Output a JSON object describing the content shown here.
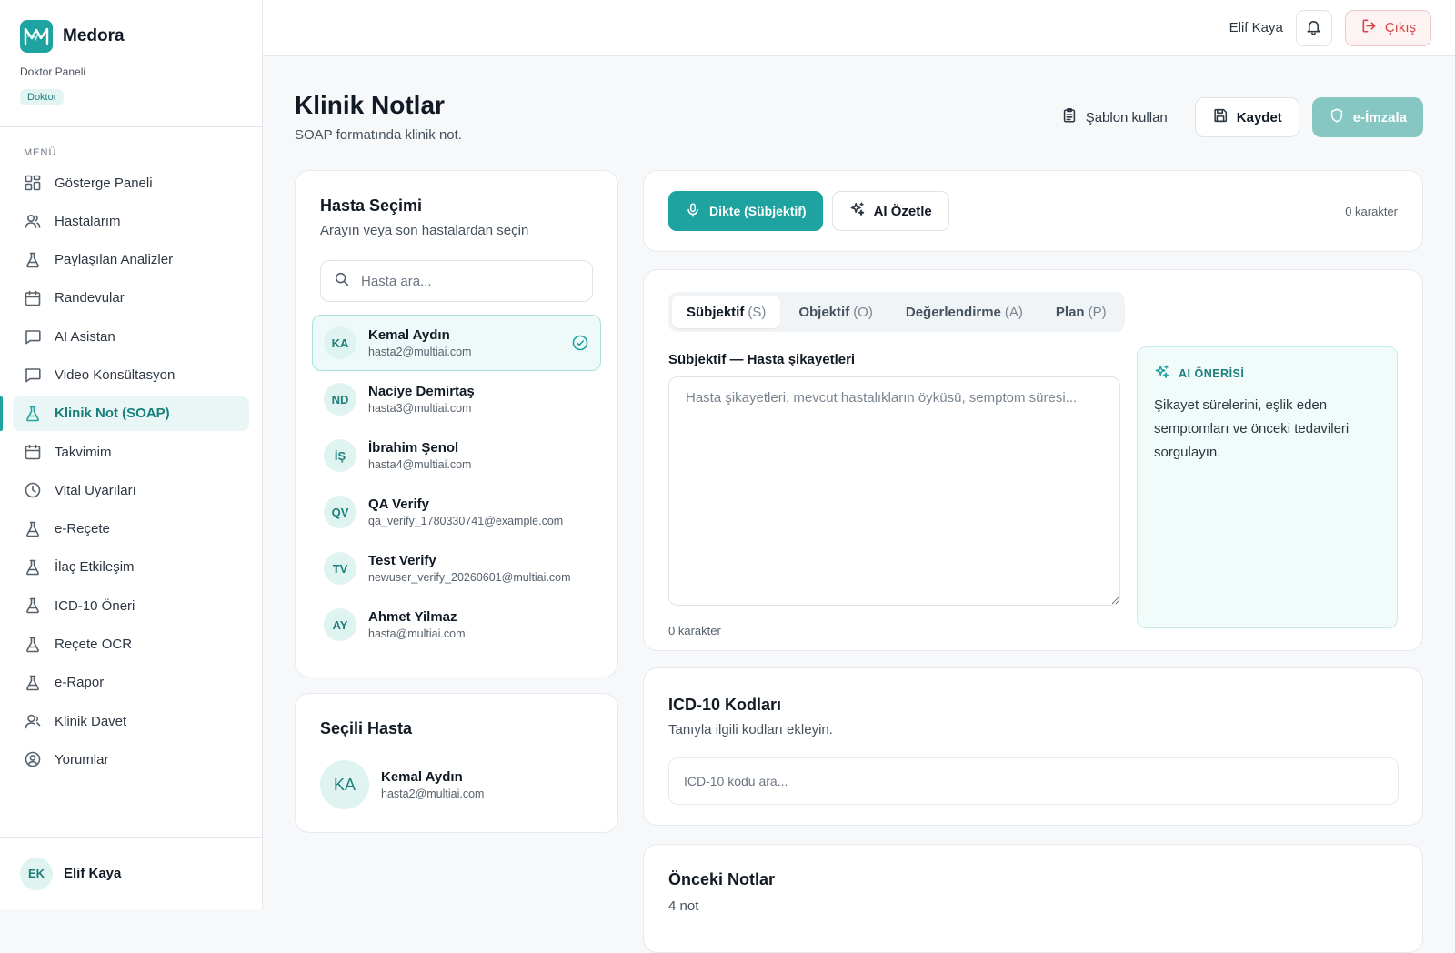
{
  "brand": {
    "name": "Medora",
    "panel": "Doktor Paneli",
    "role": "Doktor"
  },
  "menu": {
    "title": "MENÜ",
    "items": [
      {
        "label": "Gösterge Paneli",
        "icon": "grid-icon"
      },
      {
        "label": "Hastalarım",
        "icon": "users-icon"
      },
      {
        "label": "Paylaşılan Analizler",
        "icon": "flask-icon"
      },
      {
        "label": "Randevular",
        "icon": "calendar-icon"
      },
      {
        "label": "AI Asistan",
        "icon": "chat-icon"
      },
      {
        "label": "Video Konsültasyon",
        "icon": "chat-icon"
      },
      {
        "label": "Klinik Not (SOAP)",
        "icon": "flask-icon",
        "active": true
      },
      {
        "label": "Takvimim",
        "icon": "calendar-icon"
      },
      {
        "label": "Vital Uyarıları",
        "icon": "clock-icon"
      },
      {
        "label": "e-Reçete",
        "icon": "flask-icon"
      },
      {
        "label": "İlaç Etkileşim",
        "icon": "flask-icon"
      },
      {
        "label": "ICD-10 Öneri",
        "icon": "flask-icon"
      },
      {
        "label": "Reçete OCR",
        "icon": "flask-icon"
      },
      {
        "label": "e-Rapor",
        "icon": "flask-icon"
      },
      {
        "label": "Klinik Davet",
        "icon": "user-plus-icon"
      },
      {
        "label": "Yorumlar",
        "icon": "user-circle-icon"
      }
    ]
  },
  "sidebar_user": {
    "initials": "EK",
    "name": "Elif Kaya"
  },
  "topbar": {
    "user": "Elif Kaya",
    "logout": "Çıkış"
  },
  "page": {
    "title": "Klinik Notlar",
    "subtitle": "SOAP formatında klinik not.",
    "template_btn": "Şablon kullan",
    "save_btn": "Kaydet",
    "sign_btn": "e-İmzala"
  },
  "patient_select": {
    "title": "Hasta Seçimi",
    "subtitle": "Arayın veya son hastalardan seçin",
    "search_placeholder": "Hasta ara...",
    "patients": [
      {
        "initials": "KA",
        "name": "Kemal Aydın",
        "email": "hasta2@multiai.com",
        "selected": true
      },
      {
        "initials": "ND",
        "name": "Naciye Demirtaş",
        "email": "hasta3@multiai.com"
      },
      {
        "initials": "İŞ",
        "name": "İbrahim Şenol",
        "email": "hasta4@multiai.com"
      },
      {
        "initials": "QV",
        "name": "QA Verify",
        "email": "qa_verify_1780330741@example.com"
      },
      {
        "initials": "TV",
        "name": "Test Verify",
        "email": "newuser_verify_20260601@multiai.com"
      },
      {
        "initials": "AY",
        "name": "Ahmet Yilmaz",
        "email": "hasta@multiai.com"
      }
    ]
  },
  "selected_patient": {
    "title": "Seçili Hasta",
    "initials": "KA",
    "name": "Kemal Aydın",
    "email": "hasta2@multiai.com"
  },
  "dictation": {
    "dictate_btn": "Dikte (Sübjektif)",
    "summarize_btn": "AI Özetle",
    "char_count": "0 karakter"
  },
  "soap": {
    "tabs": [
      {
        "label": "Sübjektif",
        "abbr": "(S)",
        "active": true
      },
      {
        "label": "Objektif",
        "abbr": "(O)"
      },
      {
        "label": "Değerlendirme",
        "abbr": "(A)"
      },
      {
        "label": "Plan",
        "abbr": "(P)"
      }
    ],
    "field_label": "Sübjektif — Hasta şikayetleri",
    "placeholder": "Hasta şikayetleri, mevcut hastalıkların öyküsü, semptom süresi...",
    "char_count": "0 karakter",
    "ai_title": "AI ÖNERİSİ",
    "ai_text": "Şikayet sürelerini, eşlik eden semptomları ve önceki tedavileri sorgulayın."
  },
  "icd": {
    "title": "ICD-10 Kodları",
    "subtitle": "Tanıyla ilgili kodları ekleyin.",
    "placeholder": "ICD-10 kodu ara..."
  },
  "previous_notes": {
    "title": "Önceki Notlar",
    "count": "4 not"
  },
  "colors": {
    "accent": "#1fa3a0",
    "danger": "#d64545"
  }
}
